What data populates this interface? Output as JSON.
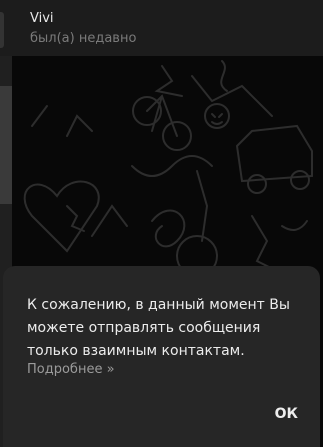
{
  "header": {
    "title": "Vivi",
    "status": "был(а) недавно"
  },
  "dialog": {
    "message": "К сожалению, в данный момент Вы можете отправлять сообщения только взаимным контактам.",
    "more_link": "Подробнее »",
    "ok_button": "ОК"
  }
}
